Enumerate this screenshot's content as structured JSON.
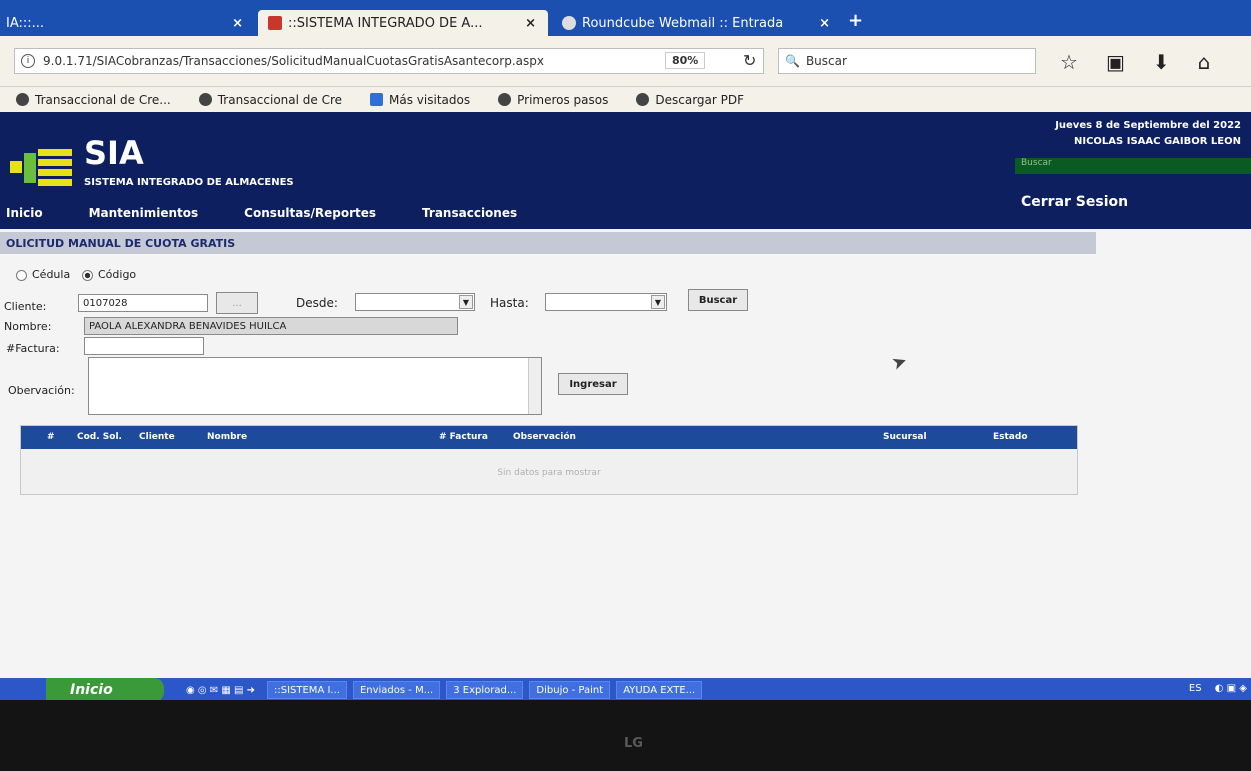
{
  "browser": {
    "tabs": [
      {
        "label": "IA:::...",
        "close": "×"
      },
      {
        "label": "::SISTEMA INTEGRADO DE A...",
        "close": "×"
      },
      {
        "label": "Roundcube Webmail :: Entrada",
        "close": "×"
      }
    ],
    "new_tab": "+",
    "url": "9.0.1.71/SIACobranzas/Transacciones/SolicitudManualCuotasGratisAsantecorp.aspx",
    "zoom": "80%",
    "search_placeholder": "Buscar",
    "bookmarks": [
      "Transaccional de Cre...",
      "Transaccional de Cre",
      "Más visitados",
      "Primeros pasos",
      "Descargar PDF"
    ]
  },
  "app": {
    "name": "SIA",
    "subtitle": "SISTEMA INTEGRADO DE ALMACENES",
    "date": "Jueves 8 de Septiembre del 2022",
    "user": "NICOLAS ISAAC GAIBOR LEON",
    "search_label": "Buscar",
    "logout": "Cerrar Sesion",
    "menu": [
      "Inicio",
      "Mantenimientos",
      "Consultas/Reportes",
      "Transacciones"
    ]
  },
  "form": {
    "section_title": "OLICITUD MANUAL DE CUOTA GRATIS",
    "radio_cedula": "Cédula",
    "radio_codigo": "Código",
    "cliente_label": "Cliente:",
    "cliente_value": "0107028",
    "lookup_label": "...",
    "desde_label": "Desde:",
    "hasta_label": "Hasta:",
    "buscar_label": "Buscar",
    "nombre_label": "Nombre:",
    "nombre_value": "PAOLA ALEXANDRA BENAVIDES HUILCA",
    "factura_label": "#Factura:",
    "observacion_label": "Obervación:",
    "ingresar_label": "Ingresar"
  },
  "grid": {
    "columns": [
      "#",
      "Cod. Sol.",
      "Cliente",
      "Nombre",
      "# Factura",
      "Observación",
      "Sucursal",
      "Estado"
    ],
    "empty_text": "Sin datos para mostrar"
  },
  "taskbar": {
    "start": "Inicio",
    "tasks": [
      "::SISTEMA I...",
      "Enviados - M...",
      "3 Explorad...",
      "Dibujo - Paint",
      "AYUDA EXTE..."
    ],
    "lang": "ES"
  },
  "monitor_brand": "LG"
}
